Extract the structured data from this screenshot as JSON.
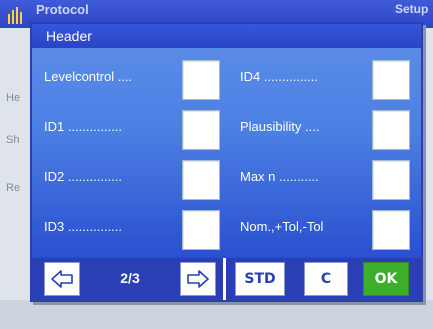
{
  "background": {
    "title": "Protocol",
    "title_right": "Setup",
    "side_items": [
      "He",
      "Sh",
      "Re"
    ]
  },
  "dialog": {
    "title": "Header",
    "left_column": [
      {
        "label": "Levelcontrol ...."
      },
      {
        "label": "ID1 ..............."
      },
      {
        "label": "ID2 ..............."
      },
      {
        "label": "ID3 ..............."
      }
    ],
    "right_column": [
      {
        "label": "ID4 ..............."
      },
      {
        "label": "Plausibility ...."
      },
      {
        "label": "Max n ..........."
      },
      {
        "label": "Nom.,+Tol,-Tol"
      }
    ]
  },
  "footer": {
    "page_indicator": "2/3",
    "std_label": "STD",
    "clear_label": "C",
    "ok_label": "OK"
  },
  "colors": {
    "accent": "#2a3fb6",
    "ok": "#3cae2a"
  }
}
